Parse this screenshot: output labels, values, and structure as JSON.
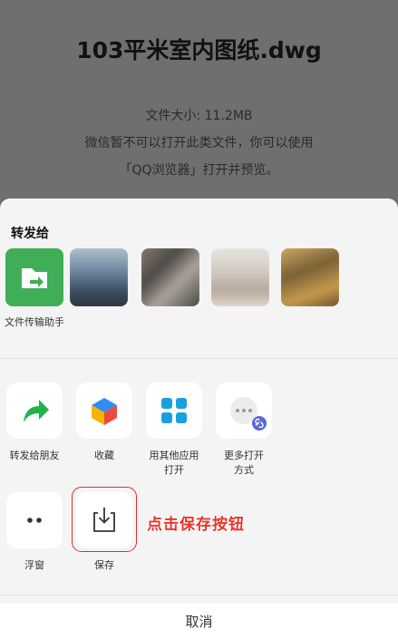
{
  "file": {
    "title": "103平米室内图纸.dwg",
    "size": "文件大小: 11.2MB",
    "notice_line1": "微信暂不可以打开此类文件，你可以使用",
    "notice_line2": "「QQ浏览器」打开并预览。"
  },
  "share": {
    "label": "转发给",
    "contacts": [
      {
        "name": "文件传输助手"
      },
      {
        "name": ""
      },
      {
        "name": ""
      },
      {
        "name": ""
      },
      {
        "name": ""
      }
    ]
  },
  "actions_row1": [
    {
      "label": "转发给朋友",
      "icon": "forward-arrow-icon",
      "color": "#22b24c"
    },
    {
      "label": "收藏",
      "icon": "favorite-cube-icon"
    },
    {
      "label": "用其他应用打开",
      "icon": "apps-grid-icon",
      "color": "#1a9fe0"
    },
    {
      "label": "更多打开方式",
      "icon": "more-dots-icon"
    }
  ],
  "actions_row2": [
    {
      "label": "浮窗",
      "icon": "float-window-icon"
    },
    {
      "label": "保存",
      "icon": "save-download-icon"
    }
  ],
  "annotation": "点击保存按钮",
  "cancel_label": "取消",
  "colors": {
    "accent_green": "#22b24c",
    "annotation_red": "#e8352c",
    "blue": "#1a9fe0"
  }
}
